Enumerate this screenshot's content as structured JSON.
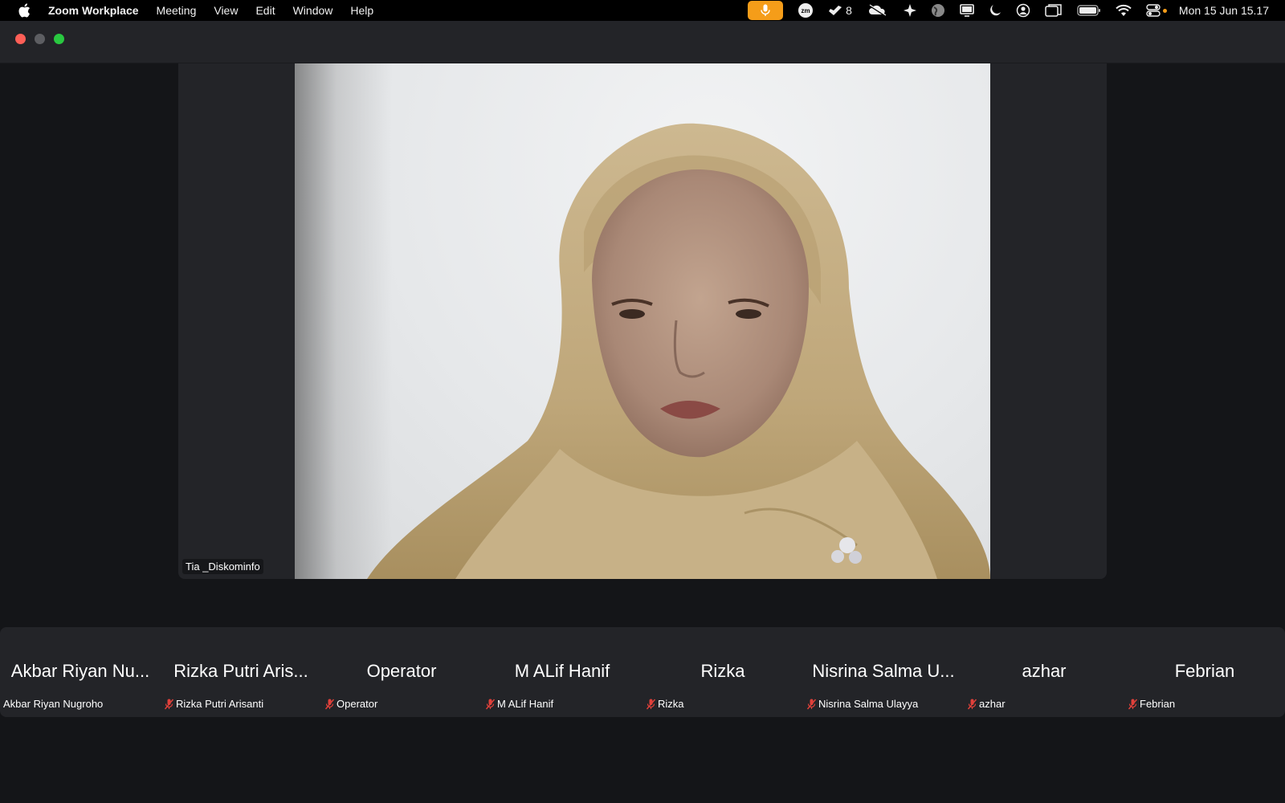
{
  "menubar": {
    "app_name": "Zoom Workplace",
    "menus": [
      "Meeting",
      "View",
      "Edit",
      "Window",
      "Help"
    ],
    "status": {
      "zm_label": "zm",
      "notification_count": "8",
      "datetime": "Mon 15 Jun  15.17",
      "mic_active_color": "#f59d19"
    }
  },
  "window": {
    "traffic_lights": [
      "close",
      "minimize",
      "zoom"
    ]
  },
  "main_video": {
    "participant_name": "Tia _Diskominfo"
  },
  "participants": [
    {
      "tile_name": "Akbar Riyan Nu...",
      "label": "Akbar Riyan Nugroho",
      "muted": false
    },
    {
      "tile_name": "Rizka Putri Aris...",
      "label": "Rizka Putri Arisanti",
      "muted": true
    },
    {
      "tile_name": "Operator",
      "label": "Operator",
      "muted": true
    },
    {
      "tile_name": "M ALif Hanif",
      "label": "M ALif Hanif",
      "muted": true
    },
    {
      "tile_name": "Rizka",
      "label": "Rizka",
      "muted": true
    },
    {
      "tile_name": "Nisrina Salma U...",
      "label": "Nisrina Salma Ulayya",
      "muted": true
    },
    {
      "tile_name": "azhar",
      "label": "azhar",
      "muted": true
    },
    {
      "tile_name": "Febrian",
      "label": "Febrian",
      "muted": true
    }
  ],
  "colors": {
    "muted_icon": "#e0403a",
    "background": "#141518",
    "panel": "#232428"
  }
}
